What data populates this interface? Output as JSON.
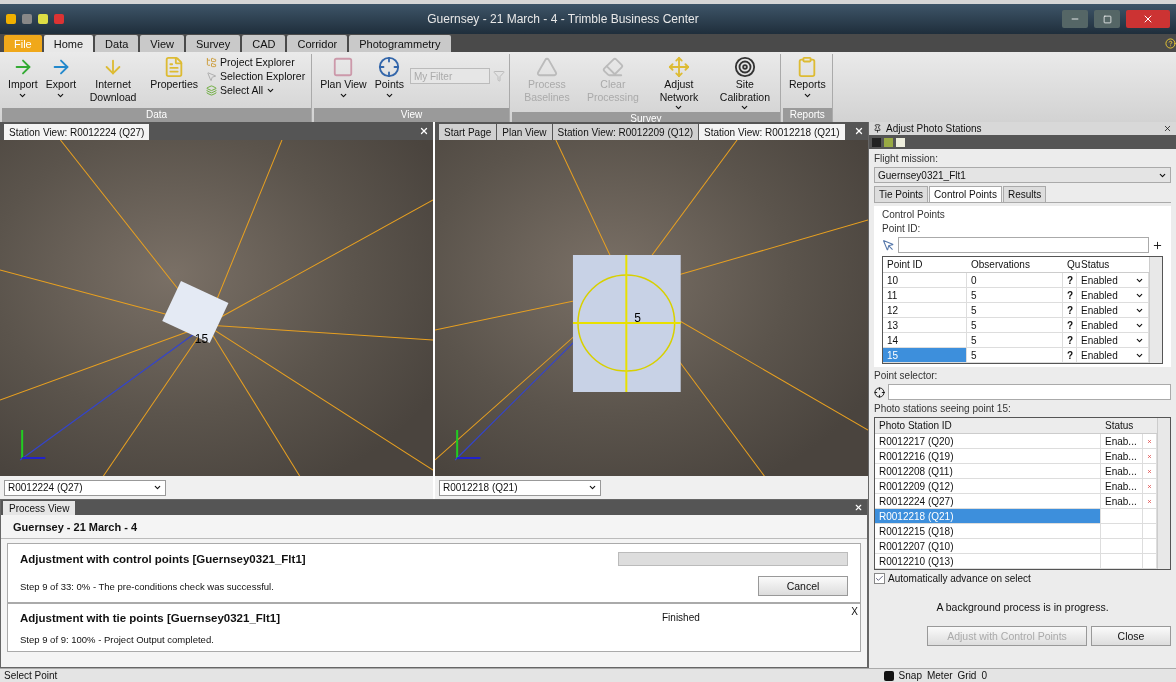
{
  "window": {
    "title": "Guernsey - 21 March - 4 - Trimble Business Center"
  },
  "ribbon_tabs": [
    {
      "label": "File",
      "kind": "file",
      "selected": false
    },
    {
      "label": "Home",
      "kind": "tab",
      "selected": true
    },
    {
      "label": "Data",
      "kind": "tab",
      "selected": false
    },
    {
      "label": "View",
      "kind": "tab",
      "selected": false
    },
    {
      "label": "Survey",
      "kind": "tab",
      "selected": false
    },
    {
      "label": "CAD",
      "kind": "tab",
      "selected": false
    },
    {
      "label": "Corridor",
      "kind": "tab",
      "selected": false
    },
    {
      "label": "Photogrammetry",
      "kind": "tab",
      "selected": false
    }
  ],
  "ribbon_groups": [
    {
      "label": "Data",
      "items": [
        {
          "kind": "large",
          "label": "Import",
          "dropdown": true,
          "disabled": false
        },
        {
          "kind": "large",
          "label": "Export",
          "dropdown": true,
          "disabled": false
        },
        {
          "kind": "large",
          "label": "Internet Download",
          "dropdown": false,
          "disabled": false
        },
        {
          "kind": "large",
          "label": "Properties",
          "dropdown": false,
          "disabled": false
        },
        {
          "kind": "small",
          "label": "Project Explorer",
          "dropdown": false,
          "disabled": false
        },
        {
          "kind": "small",
          "label": "Selection Explorer",
          "dropdown": false,
          "disabled": false
        },
        {
          "kind": "small",
          "label": "Select All",
          "dropdown": true,
          "disabled": false
        }
      ]
    },
    {
      "label": "View",
      "items": [
        {
          "kind": "large",
          "label": "Plan View",
          "dropdown": true,
          "disabled": false
        },
        {
          "kind": "large",
          "label": "Points",
          "dropdown": true,
          "disabled": false
        },
        {
          "kind": "filter",
          "label": "My Filter",
          "disabled": true
        }
      ]
    },
    {
      "label": "Survey",
      "items": [
        {
          "kind": "large",
          "label": "Process Baselines",
          "dropdown": false,
          "disabled": true
        },
        {
          "kind": "large",
          "label": "Clear Processing",
          "dropdown": false,
          "disabled": true
        },
        {
          "kind": "large",
          "label": "Adjust Network",
          "dropdown": true,
          "disabled": false
        },
        {
          "kind": "large",
          "label": "Site Calibration",
          "dropdown": true,
          "disabled": false
        }
      ]
    },
    {
      "label": "Reports",
      "items": [
        {
          "kind": "large",
          "label": "Reports",
          "dropdown": true,
          "disabled": false
        }
      ]
    }
  ],
  "views": [
    {
      "tabs": [
        {
          "label": "Station View: R0012224 (Q27)",
          "selected": true
        }
      ],
      "point_label": "15",
      "station": "R0012224 (Q27)"
    },
    {
      "tabs": [
        {
          "label": "Start Page",
          "selected": false
        },
        {
          "label": "Plan View",
          "selected": false
        },
        {
          "label": "Station View: R0012209 (Q12)",
          "selected": false
        },
        {
          "label": "Station View: R0012218 (Q21)",
          "selected": true
        }
      ],
      "point_label": "5",
      "station": "R0012218 (Q21)"
    }
  ],
  "process_view": {
    "tab": "Process View",
    "project": "Guernsey - 21 March - 4",
    "jobs": [
      {
        "kind": "running",
        "title": "Adjustment with control points [Guernsey0321_Flt1]",
        "step": "Step 9 of 33: 0% - The pre-conditions check was successful.",
        "level": 0,
        "button": "Cancel"
      },
      {
        "kind": "finished",
        "title": "Adjustment with tie points [Guernsey0321_Flt1]",
        "step": "Step 9 of 9: 100% - Project Output completed.",
        "status": "Finished",
        "close": "X"
      }
    ]
  },
  "panel": {
    "title": "Adjust Photo Stations",
    "flight_mission_label": "Flight mission:",
    "flight_mission": "Guernsey0321_Flt1",
    "tabs": [
      {
        "label": "Tie Points",
        "selected": false
      },
      {
        "label": "Control Points",
        "selected": true
      },
      {
        "label": "Results",
        "selected": false
      }
    ],
    "section": "Control Points",
    "point_id_label": "Point ID:",
    "control_columns": [
      "Point ID",
      "Observations",
      "Qu",
      "Status"
    ],
    "control_points": [
      {
        "id": "10",
        "observations": "0",
        "quality": "?",
        "status": "Enabled",
        "selected": false
      },
      {
        "id": "11",
        "observations": "5",
        "quality": "?",
        "status": "Enabled",
        "selected": false
      },
      {
        "id": "12",
        "observations": "5",
        "quality": "?",
        "status": "Enabled",
        "selected": false
      },
      {
        "id": "13",
        "observations": "5",
        "quality": "?",
        "status": "Enabled",
        "selected": false
      },
      {
        "id": "14",
        "observations": "5",
        "quality": "?",
        "status": "Enabled",
        "selected": false
      },
      {
        "id": "15",
        "observations": "5",
        "quality": "?",
        "status": "Enabled",
        "selected": true
      }
    ],
    "point_selector_label": "Point selector:",
    "stations_label": "Photo stations seeing point 15:",
    "station_columns": [
      "Photo Station ID",
      "Status"
    ],
    "stations": [
      {
        "id": "R0012217 (Q20)",
        "status": "Enab...",
        "removable": true,
        "selected": false
      },
      {
        "id": "R0012216 (Q19)",
        "status": "Enab...",
        "removable": true,
        "selected": false
      },
      {
        "id": "R0012208 (Q11)",
        "status": "Enab...",
        "removable": true,
        "selected": false
      },
      {
        "id": "R0012209 (Q12)",
        "status": "Enab...",
        "removable": true,
        "selected": false
      },
      {
        "id": "R0012224 (Q27)",
        "status": "Enab...",
        "removable": true,
        "selected": false
      },
      {
        "id": "R0012218 (Q21)",
        "removable": false,
        "selected": true
      },
      {
        "id": "R0012215 (Q18)",
        "removable": false,
        "selected": false
      },
      {
        "id": "R0012207 (Q10)",
        "removable": false,
        "selected": false
      },
      {
        "id": "R0012210 (Q13)",
        "removable": false,
        "selected": false
      }
    ],
    "auto_advance": {
      "label": "Automatically advance on select",
      "checked": true
    },
    "message": "A background process is in progress.",
    "buttons": [
      {
        "label": "Adjust with Control Points",
        "disabled": true
      },
      {
        "label": "Close",
        "disabled": false
      }
    ]
  },
  "status_bar": {
    "text": "Select Point",
    "items": [
      "Snap",
      "Meter",
      "Grid"
    ],
    "count": "0"
  }
}
